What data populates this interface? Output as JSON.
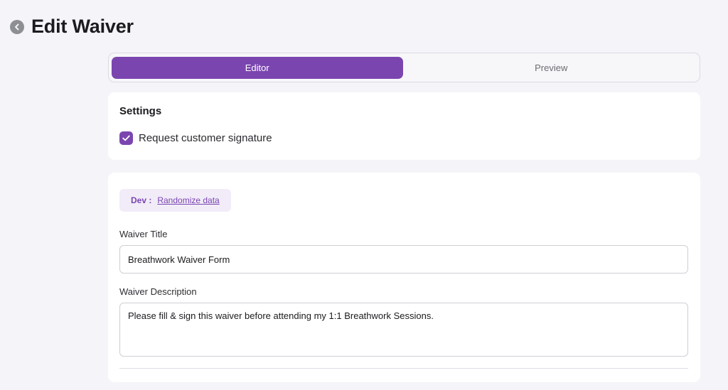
{
  "header": {
    "title": "Edit Waiver",
    "back_icon": "chevron-left-icon"
  },
  "tabs": [
    {
      "label": "Editor",
      "active": true
    },
    {
      "label": "Preview",
      "active": false
    }
  ],
  "settings": {
    "title": "Settings",
    "request_signature": {
      "label": "Request customer signature",
      "checked": true
    }
  },
  "dev": {
    "label": "Dev :",
    "link": "Randomize data"
  },
  "form": {
    "title_label": "Waiver Title",
    "title_value": "Breathwork Waiver Form",
    "description_label": "Waiver Description",
    "description_value": "Please fill & sign this waiver before attending my 1:1 Breathwork Sessions."
  },
  "colors": {
    "accent": "#7b45b0",
    "background": "#f5f4f8"
  }
}
